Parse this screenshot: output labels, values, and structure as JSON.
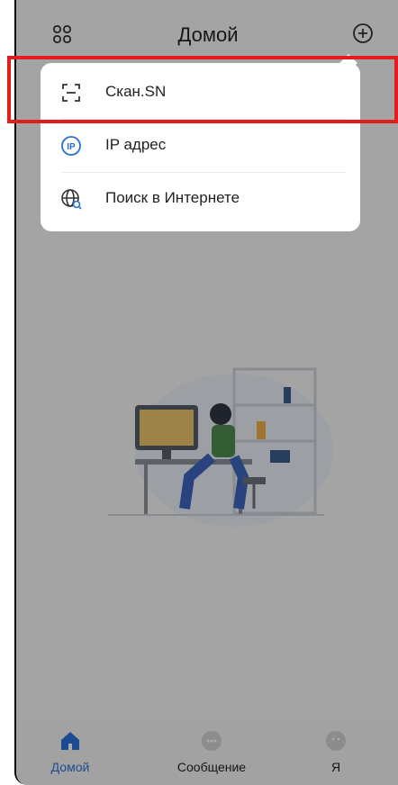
{
  "header": {
    "title": "Домой",
    "grid_icon": "grid-icon",
    "plus_icon": "plus-circle-icon"
  },
  "popup": {
    "items": [
      {
        "label": "Скан.SN",
        "icon": "scan-icon"
      },
      {
        "label": "IP адрес",
        "icon": "ip-address-icon"
      },
      {
        "label": "Поиск в Интернете",
        "icon": "globe-search-icon"
      }
    ]
  },
  "illustration": {
    "icon": "person-working-at-computer-illustration"
  },
  "tabbar": {
    "tabs": [
      {
        "label": "Домой",
        "icon": "home-icon",
        "active": true
      },
      {
        "label": "Сообщение",
        "icon": "message-icon",
        "active": false
      },
      {
        "label": "Я",
        "icon": "profile-icon",
        "active": false
      }
    ]
  },
  "colors": {
    "accent": "#2b6fd6",
    "highlight": "#e01e1e",
    "icon_muted": "#cfcfcf"
  }
}
